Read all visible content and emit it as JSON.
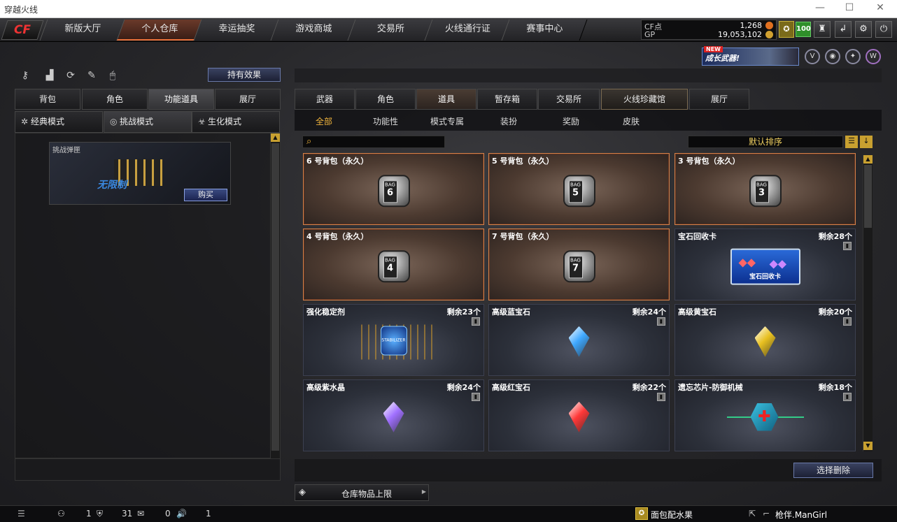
{
  "window": {
    "title": "穿越火线"
  },
  "nav": {
    "logo": "CF",
    "tabs": [
      "新版大厅",
      "个人仓库",
      "幸运抽奖",
      "游戏商城",
      "交易所",
      "火线通行证",
      "赛事中心"
    ],
    "active": 1
  },
  "currency": {
    "cf_label": "CF点",
    "cf_value": "1,268",
    "gp_label": "GP",
    "gp_value": "19,053,102"
  },
  "level": "100",
  "promo": {
    "new": "NEW",
    "text": "成长武器!"
  },
  "left": {
    "effect_button": "持有效果",
    "tabs": [
      "背包",
      "角色",
      "功能道具",
      "展厅"
    ],
    "active_tab": 2,
    "modes": [
      "经典模式",
      "挑战模式",
      "生化模式"
    ],
    "active_mode": 1,
    "item": {
      "title": "挑战弹匣",
      "overlay": "无限制",
      "buy": "购买"
    }
  },
  "right": {
    "tabs": [
      "武器",
      "角色",
      "道具",
      "暂存箱",
      "交易所",
      "火线珍藏馆",
      "展厅"
    ],
    "active_tab": 2,
    "filters": [
      "全部",
      "功能性",
      "模式专属",
      "装扮",
      "奖励",
      "皮肤"
    ],
    "active_filter": 0,
    "sort": "默认排序",
    "items": [
      {
        "name": "6 号背包（永久）",
        "remain": "",
        "style": "brown",
        "art": "bag",
        "num": "6"
      },
      {
        "name": "5 号背包（永久）",
        "remain": "",
        "style": "brown",
        "art": "bag",
        "num": "5"
      },
      {
        "name": "3 号背包（永久）",
        "remain": "",
        "style": "brown",
        "art": "bag",
        "num": "3"
      },
      {
        "name": "4 号背包（永久）",
        "remain": "",
        "style": "brown",
        "art": "bag",
        "num": "4"
      },
      {
        "name": "7 号背包（永久）",
        "remain": "",
        "style": "brown",
        "art": "bag",
        "num": "7"
      },
      {
        "name": "宝石回收卡",
        "remain": "剩余28个",
        "style": "blue",
        "art": "card",
        "card_text": "宝石回收卡"
      },
      {
        "name": "强化稳定剂",
        "remain": "剩余23个",
        "style": "blue",
        "art": "jar",
        "jar_text": "STABILIZER"
      },
      {
        "name": "高级蓝宝石",
        "remain": "剩余24个",
        "style": "blue",
        "art": "gem",
        "color": "#3fa8ff"
      },
      {
        "name": "高级黄宝石",
        "remain": "剩余20个",
        "style": "blue",
        "art": "gem",
        "color": "#e8c020"
      },
      {
        "name": "高级紫水晶",
        "remain": "剩余24个",
        "style": "blue",
        "art": "gem",
        "color": "#a070ff"
      },
      {
        "name": "高级红宝石",
        "remain": "剩余22个",
        "style": "blue",
        "art": "gem",
        "color": "#ff3838"
      },
      {
        "name": "遗忘芯片-防御机械",
        "remain": "剩余18个",
        "style": "blue",
        "art": "chip"
      }
    ],
    "select_delete": "选择删除",
    "storage_limit": "仓库物品上限"
  },
  "status": {
    "count1": "1",
    "count2": "31",
    "count3": "0",
    "count4": "1",
    "player1": "面包配水果",
    "player2": "枪伴.ManGirl"
  }
}
